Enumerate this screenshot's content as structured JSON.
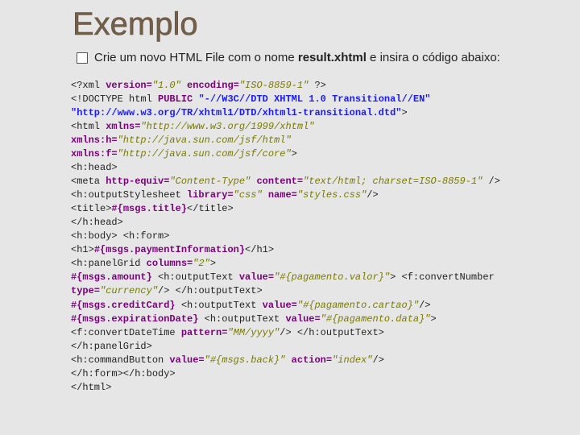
{
  "title": "Exemplo",
  "bullet": {
    "pre": "Crie um novo HTML File com o nome ",
    "bold": "result.xhtml",
    "post": " e insira o código abaixo:"
  },
  "code": {
    "l1a": "<?xml ",
    "l1b": "version=",
    "l1c": "\"1.0\"",
    "l1d": "encoding=",
    "l1e": "\"ISO-8859-1\"",
    "l1f": "?>",
    "l2a": "<!DOCTYPE html",
    "l2b": "PUBLIC",
    "l2c": "\"-//W3C//DTD XHTML 1.0 Transitional//EN\"",
    "l3": "\"http://www.w3.org/TR/xhtml1/DTD/xhtml1-transitional.dtd\"",
    "l3b": ">",
    "l4a": "<html",
    "l4b": "xmlns=",
    "l4c": "\"http://www.w3.org/1999/xhtml\"",
    "l5a": "xmlns:h=",
    "l5b": "\"http://java.sun.com/jsf/html\"",
    "l6a": "xmlns:f=",
    "l6b": "\"http://java.sun.com/jsf/core\"",
    "l6c": ">",
    "l7": "<h:head>",
    "l8a": "<meta",
    "l8b": "http-equiv=",
    "l8c": "\"Content-Type\"",
    "l8d": "content=",
    "l8e": "\"text/html; charset=ISO-8859-1\"",
    "l8f": "/>",
    "l9a": "<h:outputStylesheet",
    "l9b": "library=",
    "l9c": "\"css\"",
    "l9d": "name=",
    "l9e": "\"styles.css\"",
    "l9f": "/>",
    "l10a": "<title>",
    "l10b": "#{msgs.title}",
    "l10c": "</title>",
    "l11": "</h:head>",
    "l12": "<h:body> <h:form>",
    "l13a": "<h1>",
    "l13b": "#{msgs.paymentInformation}",
    "l13c": "</h1>",
    "l14a": "<h:panelGrid",
    "l14b": "columns=",
    "l14c": "\"2\"",
    "l14d": ">",
    "l15a": "#{msgs.amount}",
    "l15b": "<h:outputText",
    "l15c": "value=",
    "l15d": "\"#{pagamento.valor}\"",
    "l15e": "> <f:convertNumber",
    "l16a": "type=",
    "l16b": "\"currency\"",
    "l16c": "/> </h:outputText>",
    "l17a": "#{msgs.creditCard}",
    "l17b": "<h:outputText",
    "l17c": "value=",
    "l17d": "\"#{pagamento.cartao}\"",
    "l17e": "/>",
    "l18a": "#{msgs.expirationDate}",
    "l18b": "<h:outputText",
    "l18c": "value=",
    "l18d": "\"#{pagamento.data}\"",
    "l18e": ">",
    "l19a": "<f:convertDateTime",
    "l19b": "pattern=",
    "l19c": "\"MM/yyyy\"",
    "l19d": "/> </h:outputText>",
    "l20": "</h:panelGrid>",
    "l21a": "<h:commandButton",
    "l21b": "value=",
    "l21c": "\"#{msgs.back}\"",
    "l21d": "action=",
    "l21e": "\"index\"",
    "l21f": "/>",
    "l22": "</h:form></h:body>",
    "l23": "</html>"
  }
}
